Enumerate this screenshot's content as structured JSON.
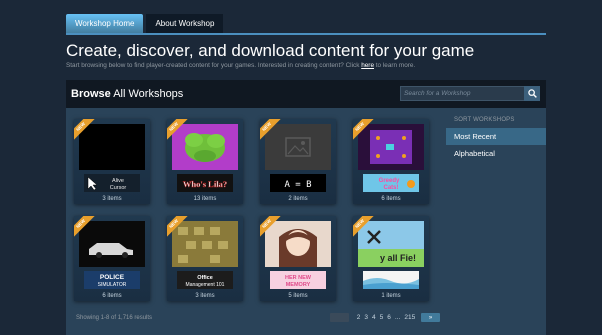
{
  "tabs": [
    {
      "label": "Workshop Home",
      "active": true
    },
    {
      "label": "About Workshop",
      "active": false
    }
  ],
  "hero": {
    "title": "Create, discover, and download content for your game",
    "subtitle": "Start browsing below to find player-created content for your games. Interested in creating content? Click",
    "link": "here",
    "after": "to learn more."
  },
  "browse": {
    "bold": "Browse",
    "rest": "All Workshops"
  },
  "search": {
    "placeholder": "Search for a Workshop"
  },
  "sidebar": {
    "heading": "SORT WORKSHOPS",
    "items": [
      {
        "label": "Most Recent",
        "active": true
      },
      {
        "label": "Alphabetical",
        "active": false
      }
    ]
  },
  "ribbon_label": "NEW",
  "cards": [
    {
      "logo": "Alive Cursor",
      "count": "3 items"
    },
    {
      "logo": "Who's Lila?",
      "count": "13 items"
    },
    {
      "logo": "A = B",
      "count": "2 items"
    },
    {
      "logo": "Greedy Cats!",
      "count": "6 items"
    },
    {
      "logo": "POLICE SIMULATOR",
      "count": "6 items"
    },
    {
      "logo": "Office Management 101",
      "count": "3 items"
    },
    {
      "logo": "HER NEW MEMORY",
      "count": "5 items"
    },
    {
      "logo": "",
      "count": "1 items"
    }
  ],
  "footer": {
    "showing": "Showing 1-8 of 1,716 results",
    "pages": [
      "2",
      "3",
      "4",
      "5",
      "6",
      "...",
      "215"
    ],
    "next": "»"
  },
  "colors": {
    "accent": "#67c1f5",
    "ribbon": "#e89f2c",
    "background": "#1b2838",
    "panel": "#2a4359"
  }
}
